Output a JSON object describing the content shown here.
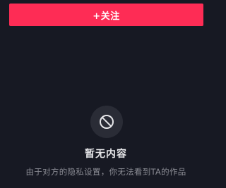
{
  "follow_button": {
    "label": "+关注",
    "color": "#fe2c55"
  },
  "empty_state": {
    "icon": "no-entry-icon",
    "title": "暂无内容",
    "description": "由于对方的隐私设置，你无法看到TA的作品"
  },
  "colors": {
    "background": "#171923",
    "icon_circle": "#2a2c36"
  }
}
